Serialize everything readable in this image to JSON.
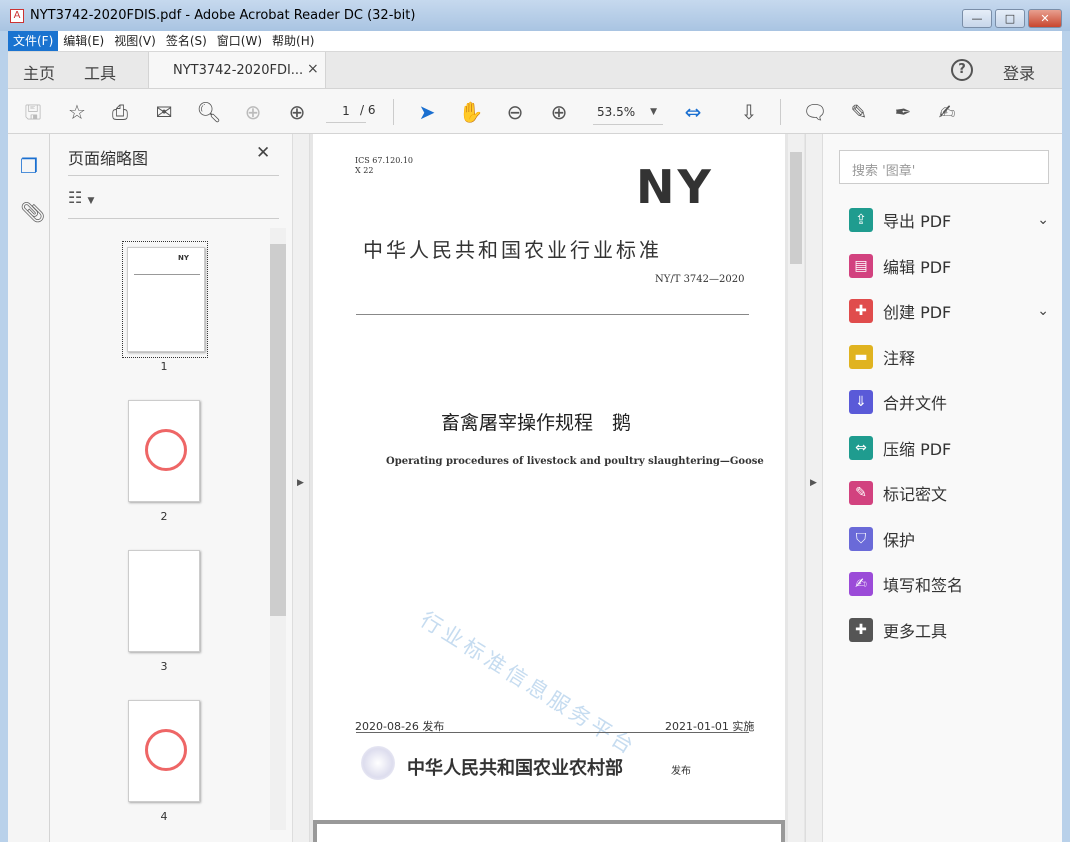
{
  "window": {
    "title": "NYT3742-2020FDIS.pdf - Adobe Acrobat Reader DC (32-bit)",
    "minimize": "—",
    "maximize": "□",
    "close": "✕"
  },
  "menu": [
    "文件(F)",
    "编辑(E)",
    "视图(V)",
    "签名(S)",
    "窗口(W)",
    "帮助(H)"
  ],
  "tabs": {
    "home": "主页",
    "tools": "工具",
    "document": "NYT3742-2020FDI...",
    "close": "×",
    "help": "?",
    "login": "登录"
  },
  "toolbar": {
    "page_current": "1",
    "page_total": "/ 6",
    "zoom": "53.5%"
  },
  "thumbnails": {
    "title": "页面缩略图",
    "close": "✕",
    "pages": [
      "1",
      "2",
      "3",
      "4"
    ]
  },
  "document": {
    "ics": "ICS 67.120.10",
    "class": "X 22",
    "logo": "NY",
    "standard_title": "中华人民共和国农业行业标准",
    "number": "NY/T 3742—2020",
    "title_cn": "畜禽屠宰操作规程　鹅",
    "title_en": "Operating procedures of livestock and poultry slaughtering—Goose",
    "watermark": "行业标准信息服务平台",
    "issue_date": "2020-08-26 发布",
    "effective_date": "2021-01-01 实施",
    "issuer": "中华人民共和国农业农村部",
    "issuer_suffix": "发布"
  },
  "right_panel": {
    "search_placeholder": "搜索 '图章'",
    "tools": [
      {
        "label": "导出 PDF",
        "color": "#1f9c8f"
      },
      {
        "label": "编辑 PDF",
        "color": "#d2427f"
      },
      {
        "label": "创建 PDF",
        "color": "#e04c4c"
      },
      {
        "label": "注释",
        "color": "#e0b320"
      },
      {
        "label": "合并文件",
        "color": "#5a5ad8"
      },
      {
        "label": "压缩 PDF",
        "color": "#1f9c8f"
      },
      {
        "label": "标记密文",
        "color": "#d2427f"
      },
      {
        "label": "保护",
        "color": "#6a6ad8"
      },
      {
        "label": "填写和签名",
        "color": "#9b4bd8"
      },
      {
        "label": "更多工具",
        "color": "#555555"
      }
    ]
  }
}
